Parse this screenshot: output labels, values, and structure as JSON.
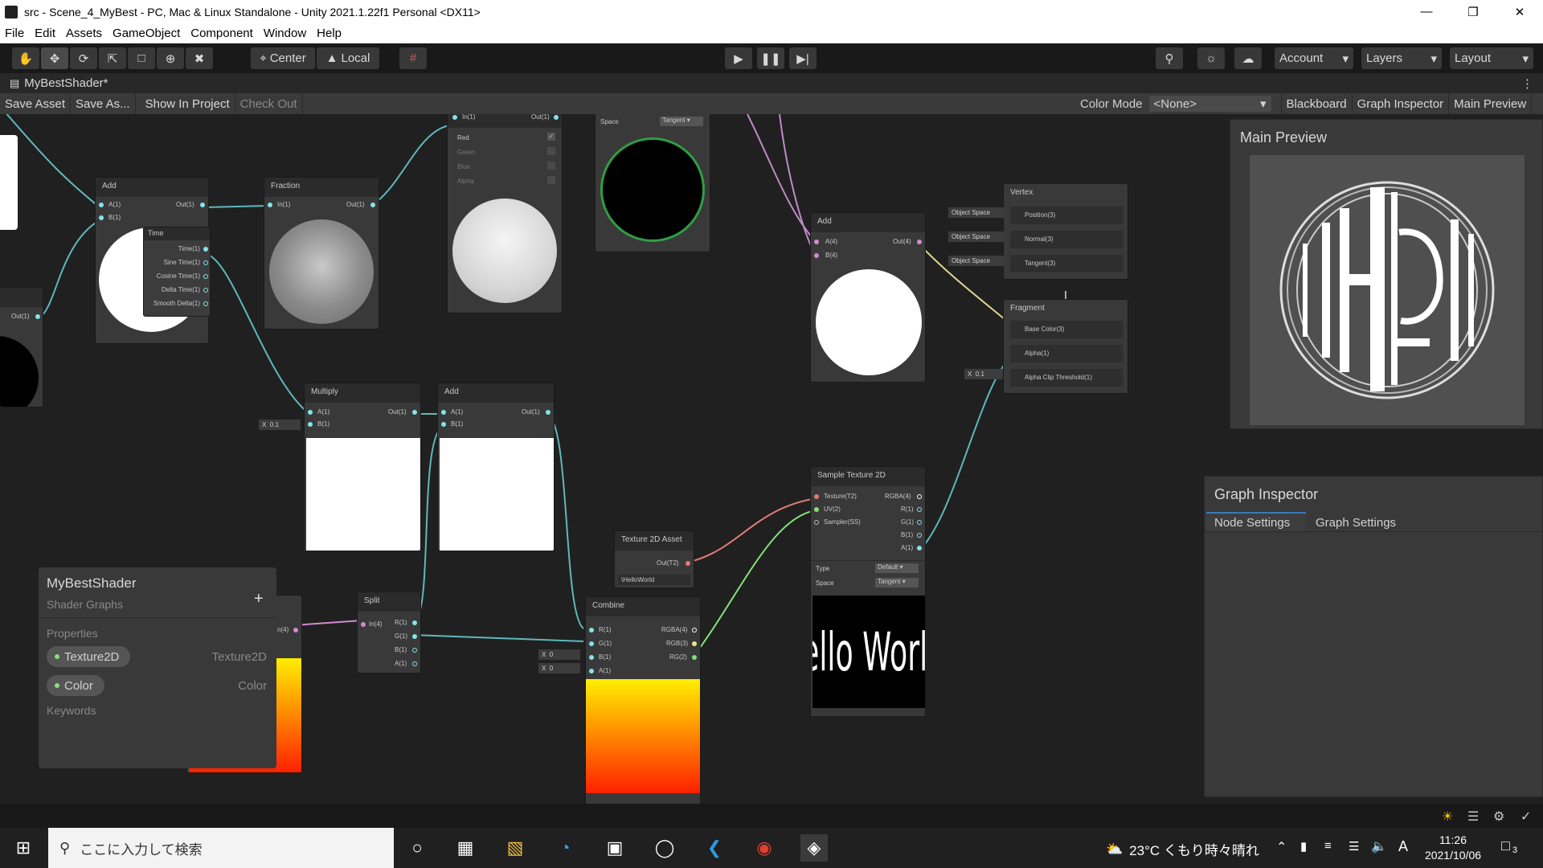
{
  "window": {
    "title": "src - Scene_4_MyBest - PC, Mac & Linux Standalone - Unity 2021.1.22f1 Personal <DX11>"
  },
  "menu": [
    "File",
    "Edit",
    "Assets",
    "GameObject",
    "Component",
    "Window",
    "Help"
  ],
  "toolbar": {
    "center": "Center",
    "local": "Local",
    "account": "Account",
    "layers": "Layers",
    "layout": "Layout"
  },
  "tab": {
    "title": "MyBestShader*"
  },
  "sg": {
    "save": "Save Asset",
    "save_as": "Save As...",
    "show": "Show In Project",
    "checkout": "Check Out",
    "color_mode_label": "Color Mode",
    "color_mode_value": "<None>",
    "blackboard": "Blackboard",
    "graph_inspector": "Graph Inspector",
    "main_preview": "Main Preview"
  },
  "nodes": {
    "add1": {
      "title": "Add",
      "a": "A(1)",
      "b": "B(1)",
      "out": "Out(1)"
    },
    "time": {
      "title": "Time",
      "ports": [
        "Time(1)",
        "Sine Time(1)",
        "Cosine Time(1)",
        "Delta Time(1)",
        "Smooth Delta(1)"
      ]
    },
    "fraction": {
      "title": "Fraction",
      "in": "In(1)",
      "out": "Out(1)"
    },
    "mask": {
      "in": "In(1)",
      "out": "Out(1)",
      "channels": [
        "Red",
        "Green",
        "Blue",
        "Alpha"
      ]
    },
    "normal": {
      "space_label": "Space",
      "space_value": "Tangent"
    },
    "add2": {
      "title": "Add",
      "a": "A(4)",
      "b": "B(4)",
      "out": "Out(4)"
    },
    "left_out": "Out(1)",
    "multiply": {
      "title": "Multiply",
      "a": "A(1)",
      "b": "B(1)",
      "out": "Out(1)",
      "xlabel": "X",
      "xval": "0.1"
    },
    "add3": {
      "title": "Add",
      "a": "A(1)",
      "b": "B(1)",
      "out": "Out(1)"
    },
    "split": {
      "title": "Split",
      "in": "In(4)",
      "ports": [
        "R(1)",
        "G(1)",
        "B(1)",
        "A(1)"
      ]
    },
    "combine": {
      "title": "Combine",
      "in": [
        "R(1)",
        "G(1)",
        "B(1)",
        "A(1)"
      ],
      "out": [
        "RGBA(4)",
        "RGB(3)",
        "RG(2)"
      ],
      "xlabel": "X",
      "xval": "0"
    },
    "tex2d": {
      "title": "Texture 2D Asset",
      "out": "Out(T2)",
      "value": "\\HelloWorld"
    },
    "sample": {
      "title": "Sample Texture 2D",
      "in": [
        "Texture(T2)",
        "UV(2)",
        "Sampler(SS)"
      ],
      "out": [
        "RGBA(4)",
        "R(1)",
        "G(1)",
        "B(1)",
        "A(1)"
      ],
      "type_label": "Type",
      "type_value": "Default",
      "space_label": "Space",
      "space_value": "Tangent",
      "preview_text": "ello World!  H"
    },
    "vertex": {
      "title": "Vertex",
      "ports": [
        "Position(3)",
        "Normal(3)",
        "Tangent(3)"
      ],
      "space": "Object Space"
    },
    "fragment": {
      "title": "Fragment",
      "ports": [
        "Base Color(3)",
        "Alpha(1)",
        "Alpha Clip Threshold(1)"
      ],
      "xlabel": "X",
      "xval": "0.1"
    },
    "partial_in": "n(4)"
  },
  "blackboard": {
    "title": "MyBestShader",
    "subtitle": "Shader Graphs",
    "properties": "Properties",
    "items": [
      {
        "name": "Texture2D",
        "type": "Texture2D"
      },
      {
        "name": "Color",
        "type": "Color"
      }
    ],
    "keywords": "Keywords"
  },
  "main_preview": {
    "title": "Main Preview"
  },
  "graph_inspector": {
    "title": "Graph Inspector",
    "tabs": [
      "Node Settings",
      "Graph Settings"
    ]
  },
  "taskbar": {
    "search": "ここに入力して検索",
    "weather": "23°C くもり時々晴れ",
    "ime": "A",
    "time": "11:26",
    "date": "2021/10/06",
    "notif": "3"
  }
}
